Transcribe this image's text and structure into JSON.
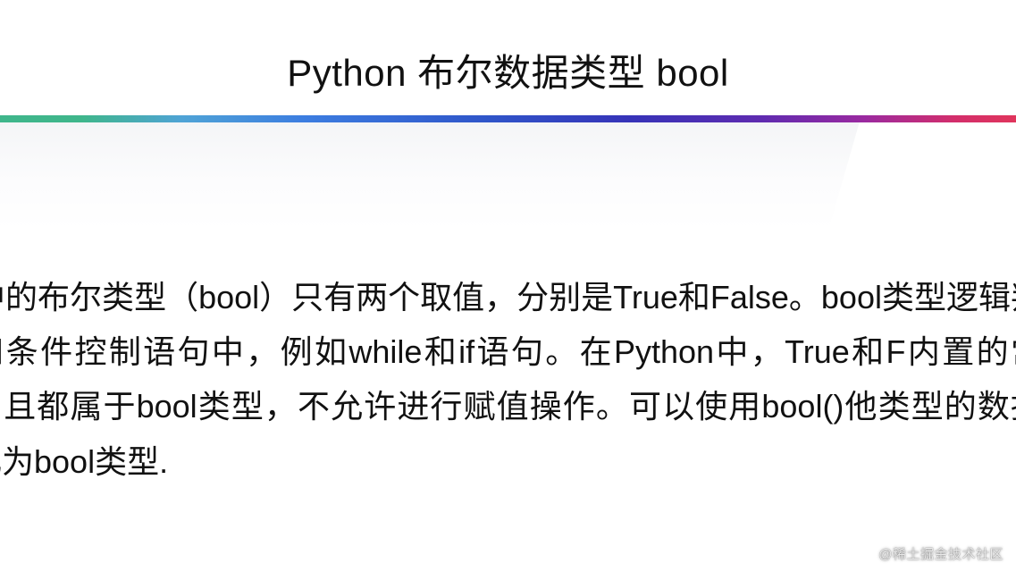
{
  "title": "Python 布尔数据类型 bool",
  "paragraph": "on中的布尔类型（bool）只有两个取值，分别是True和False。bool类型逻辑判断和条件控制语句中，例如while和if语句。在Python中，True和F内置的常量，且都属于bool类型，不允许进行赋值操作。可以使用bool()他类型的数据转化为bool类型.",
  "watermark": "@稀土掘金技术社区"
}
